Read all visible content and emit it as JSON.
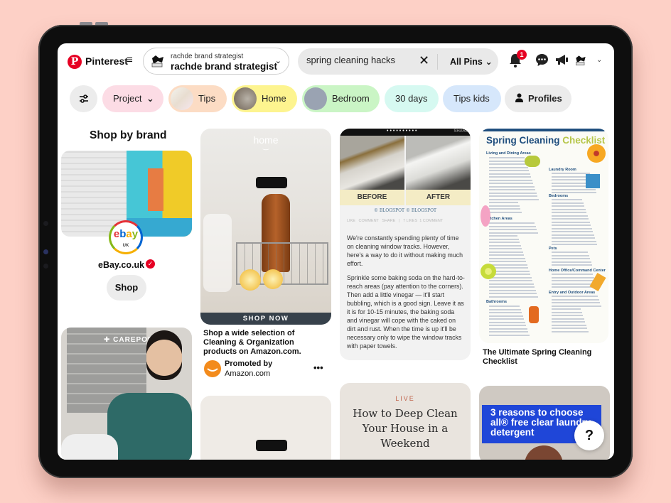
{
  "app": {
    "name": "Pinterest"
  },
  "header": {
    "account": {
      "subtitle": "rachde brand strategist",
      "name": "rachde brand strategist"
    },
    "search": {
      "value": "spring cleaning hacks",
      "scope": "All Pins"
    },
    "notifications_count": "1",
    "icons": [
      "menu-icon",
      "chevron-down-icon",
      "close-icon",
      "bell-icon",
      "chat-icon",
      "megaphone-icon",
      "avatar",
      "chevron-down-icon"
    ]
  },
  "filters": {
    "chips": [
      {
        "label": "Project",
        "color": "#fcdce5",
        "has_chevron": true
      },
      {
        "label": "Tips",
        "color": "#fcdcc4",
        "thumb": true
      },
      {
        "label": "Home",
        "color": "#fdf48f",
        "thumb": true
      },
      {
        "label": "Bedroom",
        "color": "#caf5c5",
        "thumb": true
      },
      {
        "label": "30 days",
        "color": "#d6f9f1"
      },
      {
        "label": "Tips kids",
        "color": "#d6e7fb"
      },
      {
        "label": "Profiles",
        "color": "#ececec",
        "icon": "person-icon"
      }
    ]
  },
  "shop_by_brand": {
    "title": "Shop by brand",
    "brand_logo": "ebay",
    "brand_logo_sub": "UK",
    "brand_name": "eBay.co.uk",
    "verified": true,
    "shop_label": "Shop"
  },
  "pins": {
    "amazon": {
      "image_caption": "home",
      "cta": "SHOP NOW",
      "title": "Shop a wide selection of Cleaning & Organization products on Amazon.com.",
      "promoted_label": "Promoted by",
      "promoter": "Amazon.com"
    },
    "window_tracks": {
      "before": "BEFORE",
      "after": "AFTER",
      "watermark": "© BLOGSPOT © BLOGSPOT",
      "top_right": "SHARE",
      "actions": "LIKE   COMMENT   SHARE   |   7 LIKES  1 COMMENT",
      "paragraph1": "We're constantly spending plenty of time on cleaning window tracks. However, here's a way to do it without making much effort.",
      "paragraph2": "Sprinkle some baking soda on the hard-to-reach areas (pay attention to the corners). Then add a little vinegar — it'll start bubbling, which is a good sign. Leave it as it is for 10-15 minutes, the baking soda and vinegar will cope with the caked on dirt and rust. When the time is up it'll be necessary only to wipe the window tracks with paper towels."
    },
    "checklist": {
      "heading_main": "Spring Cleaning",
      "heading_accent": "Checklist",
      "sections": [
        "Living and Dining Areas",
        "Laundry Room",
        "Bedrooms",
        "Kitchen Areas",
        "Pets",
        "Home Office/Command Center",
        "Entry and Outdoor Areas",
        "Bathrooms"
      ],
      "title": "The Ultimate Spring Cleaning Checklist"
    },
    "carepod": {
      "brand": "CAREPOD"
    },
    "live": {
      "tag": "LIVE",
      "title": "How to Deep Clean Your House in a Weekend"
    },
    "detergent": {
      "banner": "3 reasons to choose all® free clear laundry detergent"
    }
  },
  "help_button": "?"
}
